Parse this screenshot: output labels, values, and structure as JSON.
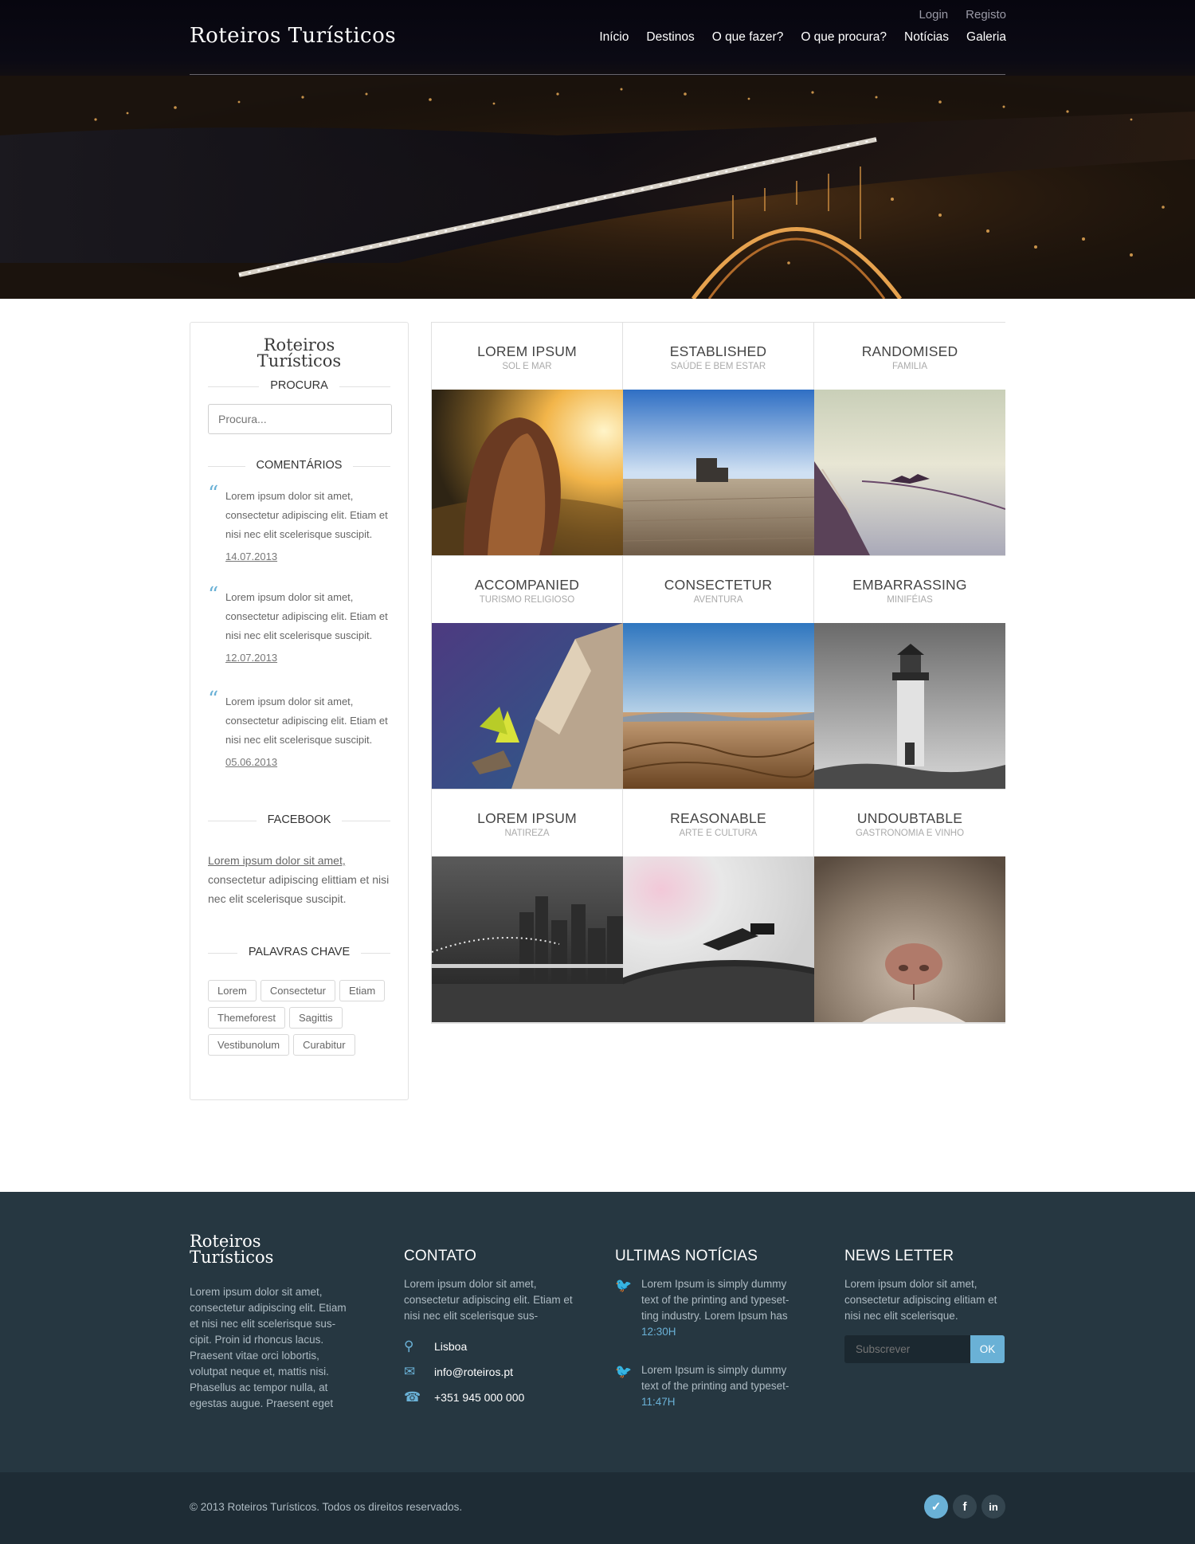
{
  "header": {
    "logo": "Roteiros Turísticos",
    "top_links": [
      "Login",
      "Registo"
    ],
    "nav": [
      "Início",
      "Destinos",
      "O que fazer?",
      "O que procura?",
      "Notícias",
      "Galeria"
    ]
  },
  "sidebar": {
    "logo_line1": "Roteiros",
    "logo_line2": "Turísticos",
    "search_heading": "PROCURA",
    "search_placeholder": "Procura...",
    "comments_heading": "COMENTÁRIOS",
    "comments": [
      {
        "text": "Lorem ipsum dolor sit amet, consectetur adipiscing elit. Etiam et nisi nec elit scelerisque suscipit.",
        "date": "14.07.2013"
      },
      {
        "text": "Lorem ipsum dolor sit amet, consectetur adipiscing elit. Etiam et nisi nec elit scelerisque suscipit.",
        "date": "12.07.2013"
      },
      {
        "text": "Lorem ipsum dolor sit amet, consectetur adipiscing elit. Etiam et nisi nec elit scelerisque suscipit.",
        "date": "05.06.2013"
      }
    ],
    "facebook_heading": "FACEBOOK",
    "facebook_link": "Lorem ipsum dolor sit amet,",
    "facebook_text": " consectetur adipiscing elittiam et nisi nec elit scelerisque suscipit.",
    "tags_heading": "PALAVRAS CHAVE",
    "tags": [
      "Lorem",
      "Consectetur",
      "Etiam",
      "Themeforest",
      "Sagittis",
      "Vestibunolum",
      "Curabitur"
    ]
  },
  "grid": [
    {
      "title": "LOREM IPSUM",
      "subtitle": "SOL E MAR",
      "image": "sunset-girl"
    },
    {
      "title": "ESTABLISHED",
      "subtitle": "SAÚDE E BEM ESTAR",
      "image": "pier"
    },
    {
      "title": "RANDOMISED",
      "subtitle": "FAMILIA",
      "image": "boat-bird"
    },
    {
      "title": "ACCOMPANIED",
      "subtitle": "TURISMO RELIGIOSO",
      "image": "plant-rock"
    },
    {
      "title": "CONSECTETUR",
      "subtitle": "AVENTURA",
      "image": "desert"
    },
    {
      "title": "EMBARRASSING",
      "subtitle": "MINIFÉIAS",
      "image": "lighthouse"
    },
    {
      "title": "LOREM IPSUM",
      "subtitle": "NATIREZA",
      "image": "city-bridge"
    },
    {
      "title": "REASONABLE",
      "subtitle": "ARTE E CULTURA",
      "image": "turntable"
    },
    {
      "title": "UNDOUBTABLE",
      "subtitle": "GASTRONOMIA E VINHO",
      "image": "cat-nose"
    }
  ],
  "footer": {
    "logo_line1": "Roteiros",
    "logo_line2": "Turísticos",
    "about": "Lorem ipsum dolor sit amet, consectetur adipiscing elit. Etiam et nisi nec elit scelerisque sus-cipit. Proin id rhoncus lacus. Praesent vitae orci lobortis, volutpat neque et, mattis nisi. Phasellus ac tempor nulla, at egestas augue. Praesent eget",
    "contact_heading": "CONTATO",
    "contact_text": "Lorem ipsum dolor sit amet, consectetur adipiscing elit. Etiam et nisi nec elit scelerisque sus-",
    "contact_location": "Lisboa",
    "contact_email": "info@roteiros.pt",
    "contact_phone": "+351 945 000 000",
    "news_heading": "ULTIMAS NOTÍCIAS",
    "news": [
      {
        "text": "Lorem Ipsum is simply dummy text of the printing and typeset-ting industry. Lorem Ipsum has",
        "time": "12:30H"
      },
      {
        "text": "Lorem Ipsum is simply dummy text of the printing and typeset-",
        "time": "11:47H"
      }
    ],
    "newsletter_heading": "NEWS LETTER",
    "newsletter_text": "Lorem ipsum dolor sit amet, consectetur adipiscing elitiam et nisi nec elit scelerisque.",
    "newsletter_placeholder": "Subscrever",
    "newsletter_button": "OK",
    "copyright": "© 2013 Roteiros Turísticos. Todos os direitos reservados.",
    "socials": [
      "twitter-icon",
      "facebook-icon",
      "linkedin-icon"
    ]
  }
}
